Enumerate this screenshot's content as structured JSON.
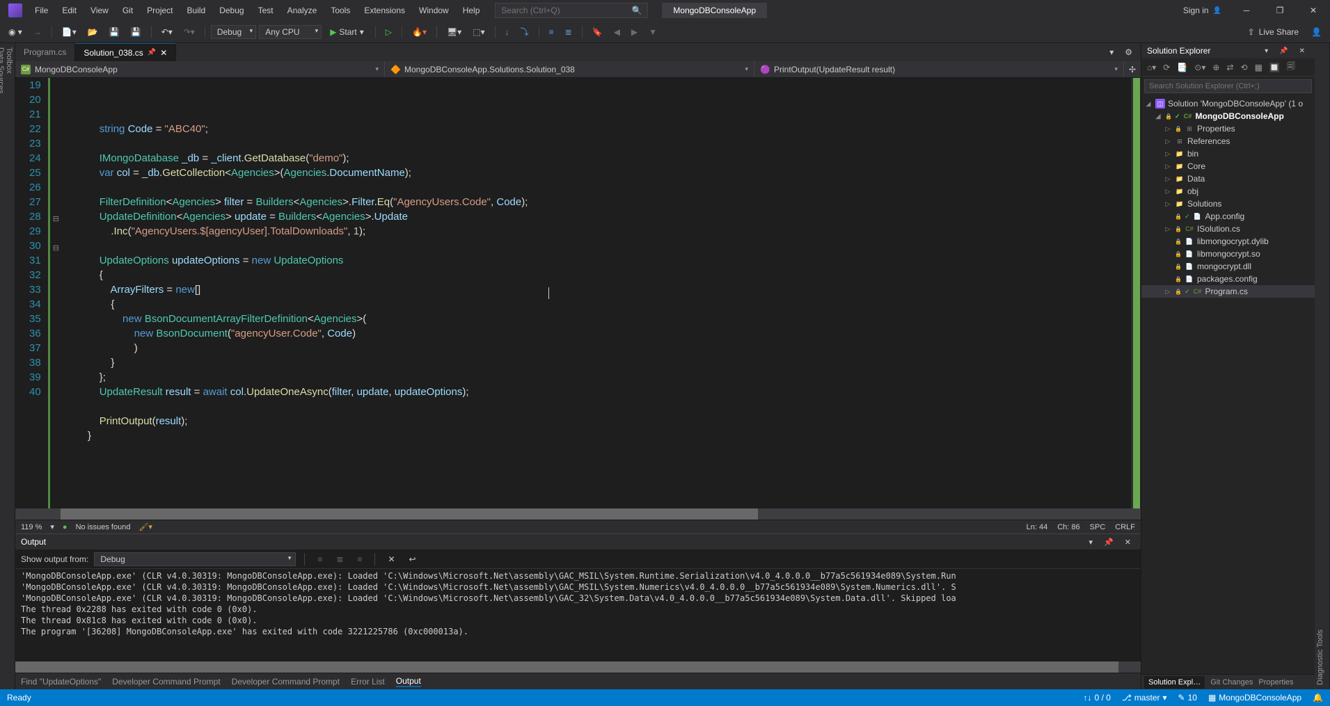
{
  "menu": [
    "File",
    "Edit",
    "View",
    "Git",
    "Project",
    "Build",
    "Debug",
    "Test",
    "Analyze",
    "Tools",
    "Extensions",
    "Window",
    "Help"
  ],
  "search_placeholder": "Search (Ctrl+Q)",
  "app_title": "MongoDBConsoleApp",
  "signin": "Sign in",
  "toolbar": {
    "config": "Debug",
    "platform": "Any CPU",
    "start": "Start",
    "live_share": "Live Share"
  },
  "side_tabs_left": [
    "Toolbox",
    "Data Sources"
  ],
  "side_tabs_right": [
    "Diagnostic Tools"
  ],
  "editor_tabs": [
    {
      "label": "Program.cs",
      "active": false
    },
    {
      "label": "Solution_038.cs",
      "active": true,
      "pinned": true
    }
  ],
  "nav": {
    "project": "MongoDBConsoleApp",
    "class": "MongoDBConsoleApp.Solutions.Solution_038",
    "member": "PrintOutput(UpdateResult result)"
  },
  "code": {
    "first_line": 19,
    "lines": [
      {
        "n": 19,
        "t": "            <span class='kw'>string</span> <span class='var'>Code</span> = <span class='str'>\"ABC40\"</span>;"
      },
      {
        "n": 20,
        "t": ""
      },
      {
        "n": 21,
        "t": "            <span class='type'>IMongoDatabase</span> <span class='var'>_db</span> = <span class='var'>_client</span>.<span class='meth'>GetDatabase</span>(<span class='str'>\"demo\"</span>);"
      },
      {
        "n": 22,
        "t": "            <span class='kw'>var</span> <span class='var'>col</span> = <span class='var'>_db</span>.<span class='meth'>GetCollection</span>&lt;<span class='type'>Agencies</span>&gt;(<span class='type'>Agencies</span>.<span class='var'>DocumentName</span>);"
      },
      {
        "n": 23,
        "t": ""
      },
      {
        "n": 24,
        "t": "            <span class='type'>FilterDefinition</span>&lt;<span class='type'>Agencies</span>&gt; <span class='var'>filter</span> = <span class='type'>Builders</span>&lt;<span class='type'>Agencies</span>&gt;.<span class='var'>Filter</span>.<span class='meth'>Eq</span>(<span class='str'>\"AgencyUsers.Code\"</span>, <span class='var'>Code</span>);"
      },
      {
        "n": 25,
        "t": "            <span class='type'>UpdateDefinition</span>&lt;<span class='type'>Agencies</span>&gt; <span class='var'>update</span> = <span class='type'>Builders</span>&lt;<span class='type'>Agencies</span>&gt;.<span class='var'>Update</span>"
      },
      {
        "n": 26,
        "t": "                .<span class='meth'>Inc</span>(<span class='str'>\"AgencyUsers.$[agencyUser].TotalDownloads\"</span>, <span class='num'>1</span>);"
      },
      {
        "n": 27,
        "t": ""
      },
      {
        "n": 28,
        "t": "            <span class='type'>UpdateOptions</span> <span class='var'>updateOptions</span> = <span class='kw'>new</span> <span class='type'>UpdateOptions</span>"
      },
      {
        "n": 29,
        "t": "            {"
      },
      {
        "n": 30,
        "t": "                <span class='var'>ArrayFilters</span> = <span class='kw'>new</span>[]"
      },
      {
        "n": 31,
        "t": "                {"
      },
      {
        "n": 32,
        "t": "                    <span class='kw'>new</span> <span class='type'>BsonDocumentArrayFilterDefinition</span>&lt;<span class='type'>Agencies</span>&gt;("
      },
      {
        "n": 33,
        "t": "                        <span class='kw'>new</span> <span class='type'>BsonDocument</span>(<span class='str'>\"agencyUser.Code\"</span>, <span class='var'>Code</span>)"
      },
      {
        "n": 34,
        "t": "                        )"
      },
      {
        "n": 35,
        "t": "                }"
      },
      {
        "n": 36,
        "t": "            };"
      },
      {
        "n": 37,
        "t": "            <span class='type'>UpdateResult</span> <span class='var'>result</span> = <span class='kw'>await</span> <span class='var'>col</span>.<span class='meth'>UpdateOneAsync</span>(<span class='var'>filter</span>, <span class='var'>update</span>, <span class='var'>updateOptions</span>);"
      },
      {
        "n": 38,
        "t": ""
      },
      {
        "n": 39,
        "t": "            <span class='meth'>PrintOutput</span>(<span class='var'>result</span>);"
      },
      {
        "n": 40,
        "t": "        }"
      }
    ]
  },
  "editor_status": {
    "zoom": "119 %",
    "issues": "No issues found",
    "ln": "Ln: 44",
    "ch": "Ch: 86",
    "spc": "SPC",
    "crlf": "CRLF"
  },
  "output": {
    "title": "Output",
    "show_label": "Show output from:",
    "source": "Debug",
    "lines": [
      "'MongoDBConsoleApp.exe' (CLR v4.0.30319: MongoDBConsoleApp.exe): Loaded 'C:\\Windows\\Microsoft.Net\\assembly\\GAC_MSIL\\System.Runtime.Serialization\\v4.0_4.0.0.0__b77a5c561934e089\\System.Run",
      "'MongoDBConsoleApp.exe' (CLR v4.0.30319: MongoDBConsoleApp.exe): Loaded 'C:\\Windows\\Microsoft.Net\\assembly\\GAC_MSIL\\System.Numerics\\v4.0_4.0.0.0__b77a5c561934e089\\System.Numerics.dll'. S",
      "'MongoDBConsoleApp.exe' (CLR v4.0.30319: MongoDBConsoleApp.exe): Loaded 'C:\\Windows\\Microsoft.Net\\assembly\\GAC_32\\System.Data\\v4.0_4.0.0.0__b77a5c561934e089\\System.Data.dll'. Skipped loa",
      "The thread 0x2288 has exited with code 0 (0x0).",
      "The thread 0x81c8 has exited with code 0 (0x0).",
      "The program '[36208] MongoDBConsoleApp.exe' has exited with code 3221225786 (0xc000013a).",
      ""
    ]
  },
  "bottom_tabs": [
    "Find \"UpdateOptions\"",
    "Developer Command Prompt",
    "Developer Command Prompt",
    "Error List",
    "Output"
  ],
  "bottom_active": 4,
  "solution_explorer": {
    "title": "Solution Explorer",
    "search_placeholder": "Search Solution Explorer (Ctrl+;)",
    "root": "Solution 'MongoDBConsoleApp' (1 o",
    "project": "MongoDBConsoleApp",
    "items": [
      {
        "icon": "ref",
        "label": "Properties",
        "indent": 2,
        "chev": "▷",
        "lock": true
      },
      {
        "icon": "ref",
        "label": "References",
        "indent": 2,
        "chev": "▷"
      },
      {
        "icon": "folder",
        "label": "bin",
        "indent": 2,
        "chev": "▷"
      },
      {
        "icon": "folder",
        "label": "Core",
        "indent": 2,
        "chev": "▷"
      },
      {
        "icon": "folder",
        "label": "Data",
        "indent": 2,
        "chev": "▷"
      },
      {
        "icon": "folder",
        "label": "obj",
        "indent": 2,
        "chev": "▷"
      },
      {
        "icon": "folder",
        "label": "Solutions",
        "indent": 2,
        "chev": "▷"
      },
      {
        "icon": "file",
        "label": "App.config",
        "indent": 2,
        "chev": "",
        "lock": true,
        "mark": "✓"
      },
      {
        "icon": "cs",
        "label": "ISolution.cs",
        "indent": 2,
        "chev": "▷",
        "lock": true
      },
      {
        "icon": "file",
        "label": "libmongocrypt.dylib",
        "indent": 2,
        "chev": "",
        "lock": true
      },
      {
        "icon": "file",
        "label": "libmongocrypt.so",
        "indent": 2,
        "chev": "",
        "lock": true
      },
      {
        "icon": "file",
        "label": "mongocrypt.dll",
        "indent": 2,
        "chev": "",
        "lock": true
      },
      {
        "icon": "file",
        "label": "packages.config",
        "indent": 2,
        "chev": "",
        "lock": true
      },
      {
        "icon": "cs",
        "label": "Program.cs",
        "indent": 2,
        "chev": "▷",
        "lock": true,
        "mark": "✓",
        "selected": true
      }
    ]
  },
  "right_bottom_tabs": [
    "Solution Expl…",
    "Git Changes",
    "Properties"
  ],
  "statusbar": {
    "ready": "Ready",
    "updown": "0 / 0",
    "branch": "master",
    "changes": "10",
    "project": "MongoDBConsoleApp"
  }
}
